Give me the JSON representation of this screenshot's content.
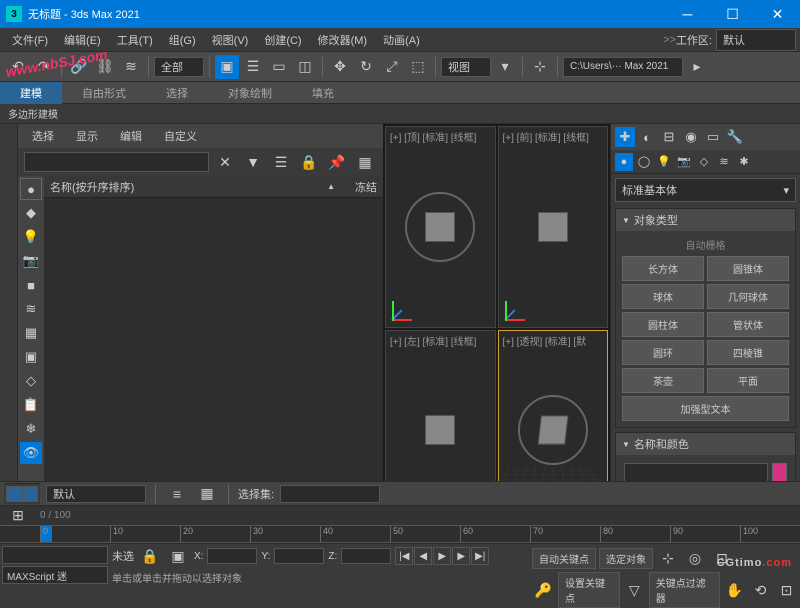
{
  "titlebar": {
    "title": "无标题 - 3ds Max 2021",
    "app_icon": "3"
  },
  "menu": {
    "items": [
      "文件(F)",
      "编辑(E)",
      "工具(T)",
      "组(G)",
      "视图(V)",
      "创建(C)",
      "修改器(M)",
      "动画(A)"
    ],
    "workspace_label": "工作区:",
    "workspace_value": "默认"
  },
  "toolbar1": {
    "dd_all": "全部",
    "dd_view": "视图",
    "path": "C:\\Users\\··· Max 2021"
  },
  "ribbon": {
    "tabs": [
      "建模",
      "自由形式",
      "选择",
      "对象绘制",
      "填充"
    ],
    "sub": "多边形建模"
  },
  "scene": {
    "menu": [
      "选择",
      "显示",
      "编辑",
      "自定义"
    ],
    "tree_col1": "名称(按升序排序)",
    "tree_sort": "▲",
    "tree_col2": "冻结"
  },
  "viewports": {
    "vp1": "[+] [顶] [标准] [线框]",
    "vp2": "[+] [前] [标准] [线框]",
    "vp3": "[+] [左] [标准] [线框]",
    "vp4": "[+] [透视] [标准] [默"
  },
  "cmdpanel": {
    "category_dd": "标准基本体",
    "roll1_title": "对象类型",
    "autogrid": "自动栅格",
    "objects": [
      "长方体",
      "圆锥体",
      "球体",
      "几何球体",
      "圆柱体",
      "管状体",
      "圆环",
      "四棱锥",
      "茶壶",
      "平面",
      "加强型文本"
    ],
    "roll2_title": "名称和颜色"
  },
  "bottom": {
    "layer": "默认",
    "selset_label": "选择集:",
    "frame": "0  /  100",
    "ticks": [
      "0",
      "10",
      "20",
      "30",
      "40",
      "50",
      "60",
      "70",
      "80",
      "90",
      "100"
    ],
    "sel_status": "未选",
    "x": "X:",
    "y": "Y:",
    "z": "Z:",
    "tip": "单击或单击并拖动以选择对象",
    "autokey": "自动关键点",
    "selobj": "选定对象",
    "setkey": "设置关键点",
    "keyfilter": "关键点过滤器",
    "maxscript": "MAXScript 迷"
  },
  "watermark1": "www.nbSJ.com",
  "watermark2": {
    "a": "CGtimo",
    "b": ".com"
  }
}
